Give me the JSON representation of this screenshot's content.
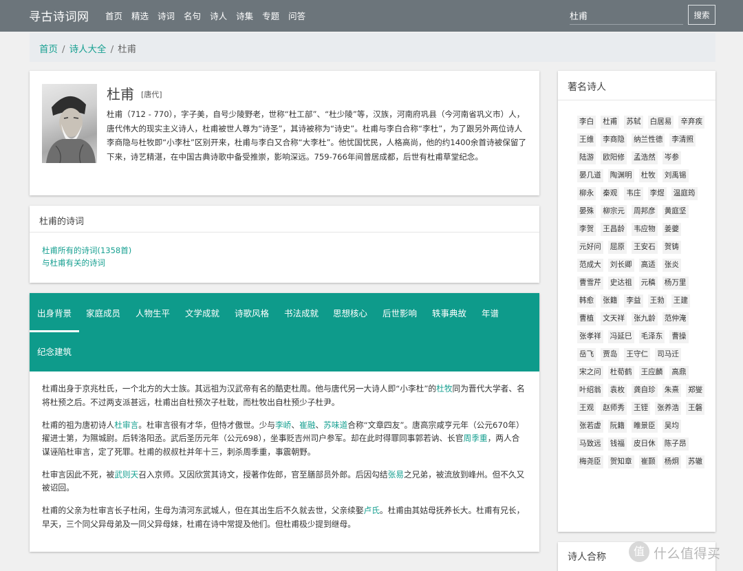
{
  "navbar": {
    "brand": "寻古诗词网",
    "links": [
      "首页",
      "精选",
      "诗词",
      "名句",
      "诗人",
      "诗集",
      "专题",
      "问答"
    ],
    "search_value": "杜甫",
    "search_button": "搜索"
  },
  "breadcrumb": {
    "home": "首页",
    "section": "诗人大全",
    "current": "杜甫"
  },
  "profile": {
    "name": "杜甫",
    "dynasty": "[唐代]",
    "bio": "杜甫（712 - 770），字子美，自号少陵野老，世称“杜工部”、“杜少陵”等，汉族，河南府巩县（今河南省巩义市）人，唐代伟大的现实主义诗人，杜甫被世人尊为“诗圣”，其诗被称为“诗史”。杜甫与李白合称“李杜”，为了跟另外两位诗人李商隐与杜牧即“小李杜”区别开来，杜甫与李白又合称“大李杜”。他忧国忧民，人格高尚，他的约1400余首诗被保留了下来，诗艺精湛，在中国古典诗歌中备受推崇，影响深远。759-766年间曾居成都，后世有杜甫草堂纪念。"
  },
  "works": {
    "title": "杜甫的诗词",
    "all_link": "杜甫所有的诗词(1358首)",
    "related_link": "与杜甫有关的诗词"
  },
  "tabs": [
    "出身背景",
    "家庭成员",
    "人物生平",
    "文学成就",
    "诗歌风格",
    "书法成就",
    "思想核心",
    "后世影响",
    "轶事典故",
    "年谱",
    "纪念建筑"
  ],
  "content": {
    "p1": [
      "杜甫出身于京兆杜氏，一个北方的大士族。其远祖为汉武帝有名的酷吏杜周。他与唐代另一大诗人即“小李杜”的",
      "杜牧",
      "同为晋代大学者、名将杜预之后。不过两支派甚远，杜甫出自杜预次子杜耽，而杜牧出自杜预少子杜尹。"
    ],
    "p2": [
      "杜甫的祖为唐初诗人",
      "杜审言",
      "。杜审言很有才华，但恃才傲世。少与",
      "李峤",
      "、",
      "崔融",
      "、",
      "苏味道",
      "合称“文章四友”。唐高宗咸亨元年（公元670年）擢进士第，为隰城尉。后转洛阳丞。武后圣历元年（公元698），坐事贬吉州司户参军。却在此时得罪同事郭若讷、长官",
      "周季重",
      "，两人合谋诬陷杜审言，定了死罪。杜甫的叔叔杜并年十三，刺杀周季重，事震朝野。"
    ],
    "p3": [
      "杜审言因此不死，被",
      "武则天",
      "召入京师。又因欣赏其诗文，授著作佐郎，官至膳部员外郎。后因勾结",
      "张易",
      "之兄弟，被流放到峰州。但不久又被诏回。"
    ],
    "p4": [
      "杜甫的父亲为杜审言长子杜闲，生母为清河东武城人，但在其出生后不久就去世，父亲续娶",
      "卢氏",
      "。杜甫由其姑母抚养长大。杜甫有兄长，早天，三个同父异母弟及一同父异母妹，杜甫在诗中常提及他们。但杜甫极少提到继母。"
    ]
  },
  "sidebar": {
    "famous_title": "著名诗人",
    "poets": [
      "李白",
      "杜甫",
      "苏轼",
      "白居易",
      "辛弃疾",
      "王维",
      "李商隐",
      "纳兰性德",
      "李清照",
      "陆游",
      "欧阳修",
      "孟浩然",
      "岑参",
      "晏几道",
      "陶渊明",
      "杜牧",
      "刘禹锡",
      "柳永",
      "秦观",
      "韦庄",
      "李煜",
      "温庭筠",
      "晏殊",
      "柳宗元",
      "周邦彦",
      "黄庭坚",
      "李贺",
      "王昌龄",
      "韦应物",
      "姜夔",
      "元好问",
      "屈原",
      "王安石",
      "贺铸",
      "范成大",
      "刘长卿",
      "高适",
      "张炎",
      "曹雪芹",
      "史达祖",
      "元稹",
      "杨万里",
      "韩愈",
      "张籍",
      "李益",
      "王勃",
      "王建",
      "曹植",
      "文天祥",
      "张九龄",
      "范仲淹",
      "张孝祥",
      "冯延巳",
      "毛泽东",
      "曹操",
      "岳飞",
      "贾岛",
      "王守仁",
      "司马迁",
      "宋之问",
      "杜荀鹤",
      "王应麟",
      "高鼎",
      "叶绍翁",
      "袁枚",
      "龚自珍",
      "朱熹",
      "郑燮",
      "王观",
      "赵师秀",
      "王铚",
      "张养浩",
      "王磐",
      "张若虚",
      "阮籍",
      "睢景臣",
      "吴均",
      "马致远",
      "钱福",
      "皮日休",
      "陈子昂",
      "梅尧臣",
      "贺知章",
      "崔颢",
      "杨炯",
      "苏辙"
    ],
    "alias_title": "诗人合称"
  },
  "watermark": {
    "glyph": "值",
    "text": "什么值得买"
  },
  "colors": {
    "navbar": "#6c757b",
    "accent": "#0e9b8b",
    "link": "#17a091"
  }
}
